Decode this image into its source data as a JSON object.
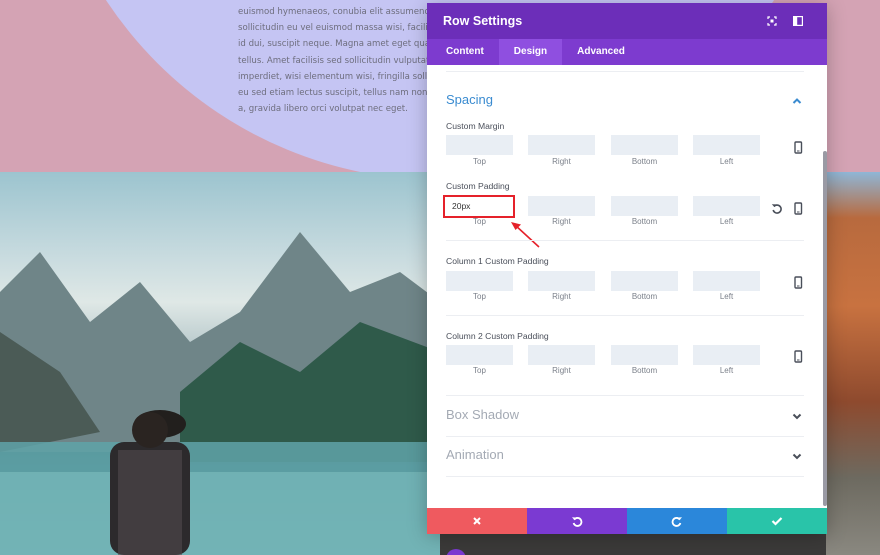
{
  "background": {
    "paragraph_lines": [
      "euismod hymenaeos, conubia elit assumenda",
      "sollicitudin eu vel euismod massa wisi, facilis",
      "id dui, suscipit neque. Magna amet eget quam",
      "tellus. Amet facilisis sed sollicitudin vulputate",
      "imperdiet, wisi elementum wisi, fringilla sollicit",
      "eu sed etiam lectus suscipit, tellus nam non pede",
      "a, gravida libero orci volutpat nec eget."
    ]
  },
  "panel": {
    "title": "Row Settings",
    "header_icons": [
      "expand-icon",
      "sidebar-layout-icon"
    ],
    "tabs": [
      {
        "label": "Content",
        "active": false
      },
      {
        "label": "Design",
        "active": true
      },
      {
        "label": "Advanced",
        "active": false
      }
    ],
    "spacing": {
      "heading": "Spacing",
      "sub_labels": [
        "Top",
        "Right",
        "Bottom",
        "Left"
      ],
      "custom_margin": {
        "label": "Custom Margin",
        "values": [
          "",
          "",
          "",
          ""
        ]
      },
      "custom_padding": {
        "label": "Custom Padding",
        "values": [
          "20px",
          "",
          "",
          ""
        ]
      },
      "column1_padding": {
        "label": "Column 1 Custom Padding",
        "values": [
          "",
          "",
          "",
          ""
        ]
      },
      "column2_padding": {
        "label": "Column 2 Custom Padding",
        "values": [
          "",
          "",
          "",
          ""
        ]
      }
    },
    "box_shadow": {
      "heading": "Box Shadow"
    },
    "animation": {
      "heading": "Animation"
    },
    "footer_icons": [
      "close-icon",
      "undo-icon",
      "redo-icon",
      "check-icon"
    ]
  },
  "colors": {
    "header": "#6c2eb9",
    "tabs": "#7d3bcf",
    "section_accent": "#3a8bd0",
    "cancel": "#ef5a5f",
    "undo": "#7b3ad2",
    "redo": "#2b87da",
    "save": "#29c4a9",
    "highlight": "#e5212a"
  }
}
